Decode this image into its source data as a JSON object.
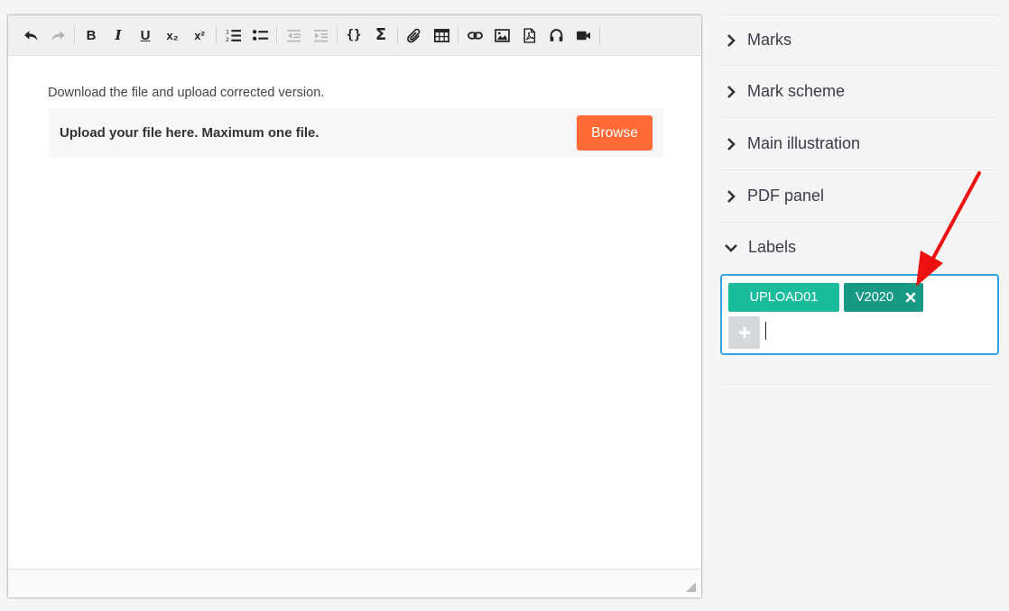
{
  "toolbar": {
    "buttons": [
      {
        "name": "undo-icon",
        "enabled": true
      },
      {
        "name": "redo-icon",
        "enabled": false
      },
      {
        "name": "bold",
        "text": "B"
      },
      {
        "name": "italic",
        "text": "I"
      },
      {
        "name": "underline",
        "text": "U"
      },
      {
        "name": "subscript",
        "text": "x₂"
      },
      {
        "name": "superscript",
        "text": "x²"
      },
      {
        "name": "numbered-list-icon"
      },
      {
        "name": "bulleted-list-icon"
      },
      {
        "name": "outdent-icon",
        "enabled": false
      },
      {
        "name": "indent-icon",
        "enabled": false
      },
      {
        "name": "code",
        "text": "{}"
      },
      {
        "name": "sigma",
        "text": "Σ"
      },
      {
        "name": "attach-icon"
      },
      {
        "name": "table-icon"
      },
      {
        "name": "link-icon"
      },
      {
        "name": "image-icon"
      },
      {
        "name": "pdf-icon"
      },
      {
        "name": "audio-icon"
      },
      {
        "name": "video-icon"
      }
    ]
  },
  "editor": {
    "instruction": "Download the file and upload corrected version.",
    "upload_label": "Upload your file here. Maximum one file.",
    "browse_label": "Browse"
  },
  "sidebar": {
    "sections": [
      "Marks",
      "Mark scheme",
      "Main illustration",
      "PDF panel"
    ],
    "labels_section": "Labels",
    "tags": [
      "UPLOAD01",
      "V2020"
    ]
  },
  "colors": {
    "browse": "#ff6a35",
    "tag": "#1bbc9b",
    "tag_selected": "#169a83",
    "focus_border": "#2ea4e6",
    "annotation_arrow": "#ee1111"
  }
}
